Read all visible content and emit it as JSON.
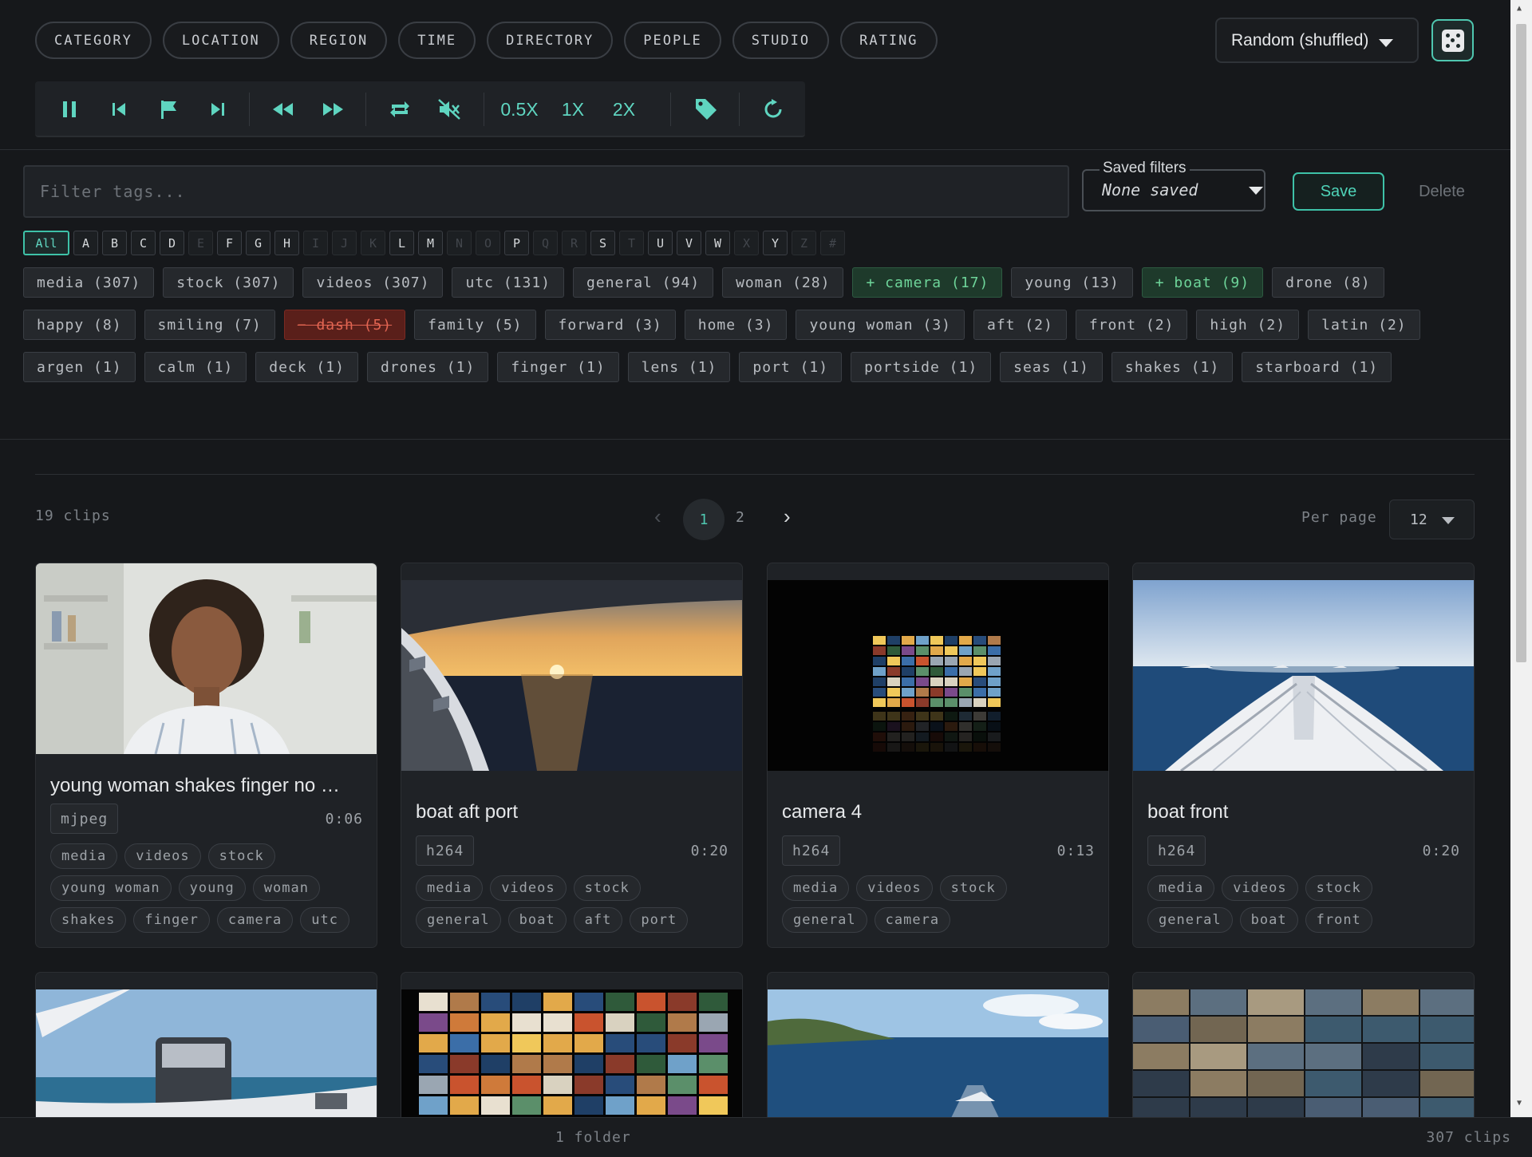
{
  "nav": {
    "items": [
      "CATEGORY",
      "LOCATION",
      "REGION",
      "TIME",
      "DIRECTORY",
      "PEOPLE",
      "STUDIO",
      "RATING"
    ],
    "sort_value": "Random (shuffled)",
    "shuffle_icon": "dice-icon"
  },
  "controls": {
    "icons": [
      "pause-icon",
      "previous-icon",
      "flag-icon",
      "next-icon",
      "rewind-icon",
      "fast-forward-icon",
      "repeat-icon",
      "mute-icon",
      "tag-icon",
      "refresh-icon"
    ],
    "speed_half": "0.5X",
    "speed_one": "1X",
    "speed_two": "2X",
    "accent": "#5fd5c0"
  },
  "filter": {
    "placeholder": "Filter tags...",
    "saved_label": "Saved filters",
    "saved_value": "None saved",
    "save_label": "Save",
    "delete_label": "Delete"
  },
  "letters": [
    {
      "label": "All",
      "state": "active"
    },
    {
      "label": "A",
      "state": "enabled"
    },
    {
      "label": "B",
      "state": "enabled"
    },
    {
      "label": "C",
      "state": "enabled"
    },
    {
      "label": "D",
      "state": "enabled"
    },
    {
      "label": "E",
      "state": "disabled"
    },
    {
      "label": "F",
      "state": "enabled"
    },
    {
      "label": "G",
      "state": "enabled"
    },
    {
      "label": "H",
      "state": "enabled"
    },
    {
      "label": "I",
      "state": "disabled"
    },
    {
      "label": "J",
      "state": "disabled"
    },
    {
      "label": "K",
      "state": "disabled"
    },
    {
      "label": "L",
      "state": "enabled"
    },
    {
      "label": "M",
      "state": "enabled"
    },
    {
      "label": "N",
      "state": "disabled"
    },
    {
      "label": "O",
      "state": "disabled"
    },
    {
      "label": "P",
      "state": "enabled"
    },
    {
      "label": "Q",
      "state": "disabled"
    },
    {
      "label": "R",
      "state": "disabled"
    },
    {
      "label": "S",
      "state": "enabled"
    },
    {
      "label": "T",
      "state": "disabled"
    },
    {
      "label": "U",
      "state": "enabled"
    },
    {
      "label": "V",
      "state": "enabled"
    },
    {
      "label": "W",
      "state": "enabled"
    },
    {
      "label": "X",
      "state": "disabled"
    },
    {
      "label": "Y",
      "state": "enabled"
    },
    {
      "label": "Z",
      "state": "disabled"
    },
    {
      "label": "#",
      "state": "disabled"
    }
  ],
  "tags": [
    {
      "label": "media (307)",
      "state": "neutral"
    },
    {
      "label": "stock (307)",
      "state": "neutral"
    },
    {
      "label": "videos (307)",
      "state": "neutral"
    },
    {
      "label": "utc (131)",
      "state": "neutral"
    },
    {
      "label": "general (94)",
      "state": "neutral"
    },
    {
      "label": "woman (28)",
      "state": "neutral"
    },
    {
      "label": "+ camera (17)",
      "state": "include"
    },
    {
      "label": "young (13)",
      "state": "neutral"
    },
    {
      "label": "+ boat (9)",
      "state": "include"
    },
    {
      "label": "drone (8)",
      "state": "neutral"
    },
    {
      "label": "happy (8)",
      "state": "neutral"
    },
    {
      "label": "smiling (7)",
      "state": "neutral"
    },
    {
      "label": "− dash (5)",
      "state": "exclude"
    },
    {
      "label": "family (5)",
      "state": "neutral"
    },
    {
      "label": "forward (3)",
      "state": "neutral"
    },
    {
      "label": "home (3)",
      "state": "neutral"
    },
    {
      "label": "young woman (3)",
      "state": "neutral"
    },
    {
      "label": "aft (2)",
      "state": "neutral"
    },
    {
      "label": "front (2)",
      "state": "neutral"
    },
    {
      "label": "high (2)",
      "state": "neutral"
    },
    {
      "label": "latin (2)",
      "state": "neutral"
    },
    {
      "label": "argen (1)",
      "state": "neutral"
    },
    {
      "label": "calm (1)",
      "state": "neutral"
    },
    {
      "label": "deck (1)",
      "state": "neutral"
    },
    {
      "label": "drones (1)",
      "state": "neutral"
    },
    {
      "label": "finger (1)",
      "state": "neutral"
    },
    {
      "label": "lens (1)",
      "state": "neutral"
    },
    {
      "label": "port (1)",
      "state": "neutral"
    },
    {
      "label": "portside (1)",
      "state": "neutral"
    },
    {
      "label": "seas (1)",
      "state": "neutral"
    },
    {
      "label": "shakes (1)",
      "state": "neutral"
    },
    {
      "label": "starboard (1)",
      "state": "neutral"
    }
  ],
  "results": {
    "clip_count": "19 clips",
    "page_current": "1",
    "page_next": "2",
    "per_page_label": "Per page",
    "per_page_value": "12"
  },
  "clips": [
    {
      "title": "young woman shakes finger no …",
      "codec": "mjpeg",
      "duration": "0:06",
      "tags": [
        "media",
        "videos",
        "stock",
        "young woman",
        "young",
        "woman",
        "shakes",
        "finger",
        "camera",
        "utc"
      ],
      "thumb": "woman"
    },
    {
      "title": "boat aft port",
      "codec": "h264",
      "duration": "0:20",
      "tags": [
        "media",
        "videos",
        "stock",
        "general",
        "boat",
        "aft",
        "port"
      ],
      "thumb": "sunset"
    },
    {
      "title": "camera 4",
      "codec": "h264",
      "duration": "0:13",
      "tags": [
        "media",
        "videos",
        "stock",
        "general",
        "camera"
      ],
      "thumb": "videowall"
    },
    {
      "title": "boat front",
      "codec": "h264",
      "duration": "0:20",
      "tags": [
        "media",
        "videos",
        "stock",
        "general",
        "boat",
        "front"
      ],
      "thumb": "bow"
    },
    {
      "thumb": "winch"
    },
    {
      "thumb": "grid"
    },
    {
      "thumb": "aerial"
    },
    {
      "thumb": "mosaic"
    }
  ],
  "footer": {
    "folder_count": "1 folder",
    "total_clips": "307 clips"
  }
}
